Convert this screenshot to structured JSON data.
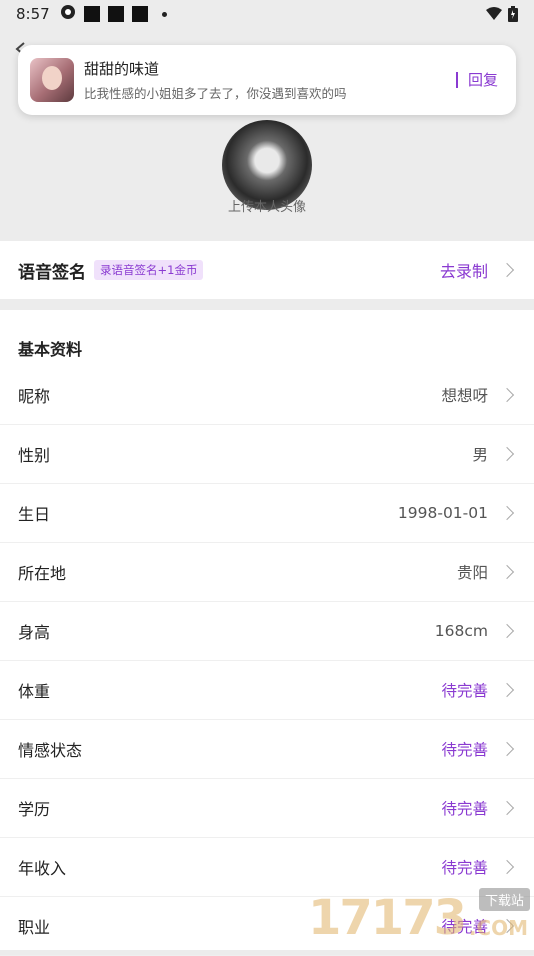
{
  "status_bar": {
    "time": "8:57"
  },
  "notification": {
    "sender": "甜甜的味道",
    "message": "比我性感的小姐姐多了去了，你没遇到喜欢的吗",
    "reply_label": "回复"
  },
  "avatar": {
    "caption": "上传本人头像"
  },
  "voice_signature": {
    "title": "语音签名",
    "badge": "录语音签名+1金币",
    "action": "去录制"
  },
  "basic_info": {
    "title": "基本资料",
    "rows": [
      {
        "label": "昵称",
        "value": "想想呀",
        "pending": false
      },
      {
        "label": "性别",
        "value": "男",
        "pending": false
      },
      {
        "label": "生日",
        "value": "1998-01-01",
        "pending": false
      },
      {
        "label": "所在地",
        "value": "贵阳",
        "pending": false
      },
      {
        "label": "身高",
        "value": "168cm",
        "pending": false
      },
      {
        "label": "体重",
        "value": "待完善",
        "pending": true
      },
      {
        "label": "情感状态",
        "value": "待完善",
        "pending": true
      },
      {
        "label": "学历",
        "value": "待完善",
        "pending": true
      },
      {
        "label": "年收入",
        "value": "待完善",
        "pending": true
      },
      {
        "label": "职业",
        "value": "待完善",
        "pending": true
      }
    ]
  },
  "watermark": {
    "number": "17173",
    "tag": "下载站",
    "suffix": ".COM"
  },
  "colors": {
    "accent": "#8a3ad1",
    "badge_bg": "#f0e1fb",
    "background": "#ececec"
  }
}
